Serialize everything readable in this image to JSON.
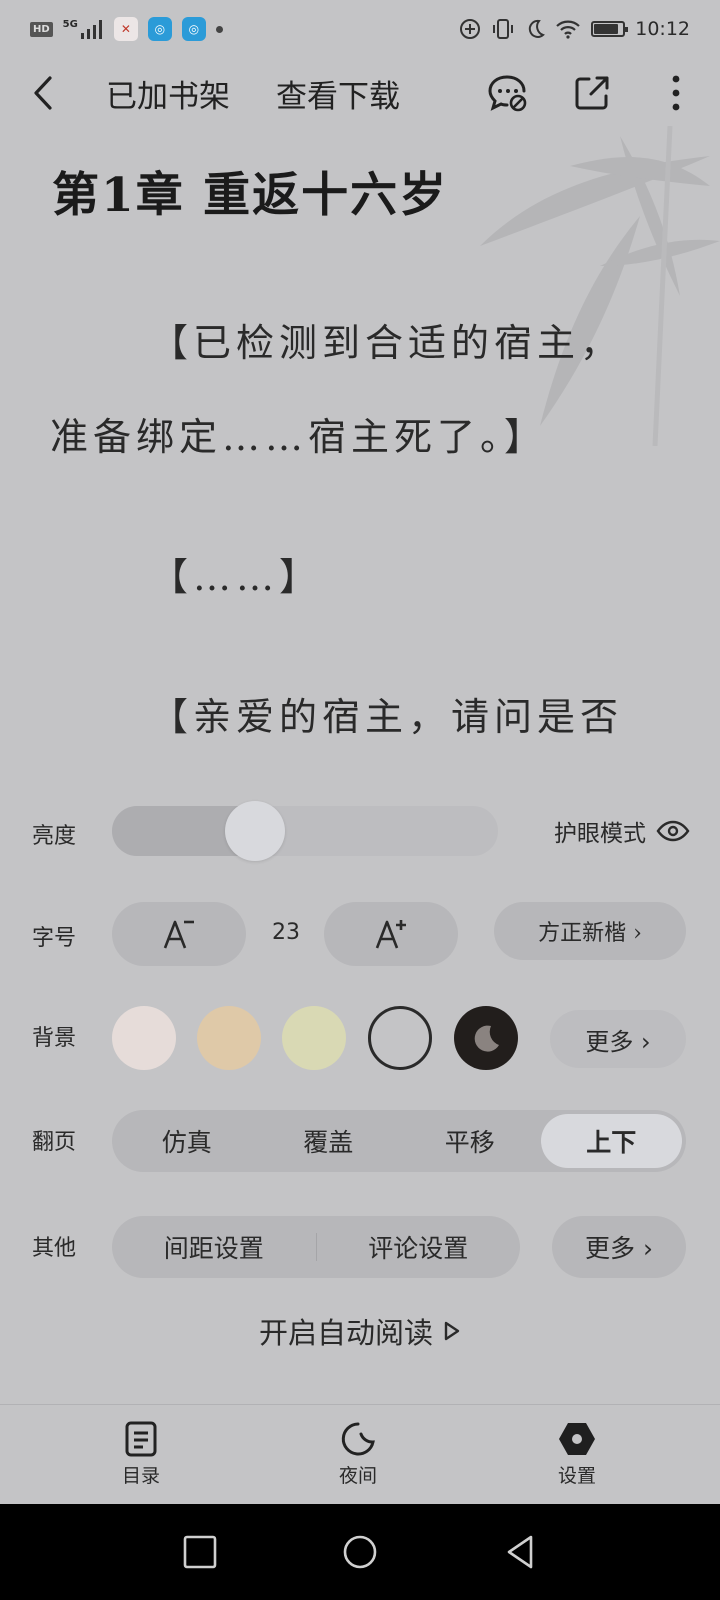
{
  "status_bar": {
    "badge": "HD",
    "network": "5G",
    "time": "10:12",
    "battery_level": 0.85
  },
  "toolbar": {
    "back_icon": "chevron-left-icon",
    "bookshelf_label": "已加书架",
    "download_label": "查看下载",
    "comment_icon": "comment-off-icon",
    "share_icon": "share-icon",
    "more_icon": "more-vertical-icon"
  },
  "reader": {
    "chapter_title": "第1章 重返十六岁",
    "paragraphs": [
      "【已检测到合适的宿主，",
      "准备绑定……宿主死了。】",
      "【……】",
      "【亲爱的宿主，请问是否"
    ]
  },
  "settings": {
    "brightness": {
      "label": "亮度",
      "level": 0.37,
      "eye_mode_label": "护眼模式"
    },
    "font": {
      "label": "字号",
      "decrease_label": "A−",
      "increase_label": "A+",
      "size_value": "23",
      "font_name": "方正新楷 ›"
    },
    "background": {
      "label": "背景",
      "swatches": [
        "#e6dcd9",
        "#dfc9a8",
        "#d9d9b4",
        "#c4c4c6",
        "#221e1c"
      ],
      "selected_index": 3,
      "more_label": "更多 ›"
    },
    "page_turn": {
      "label": "翻页",
      "options": [
        "仿真",
        "覆盖",
        "平移",
        "上下"
      ],
      "selected": "上下"
    },
    "other": {
      "label": "其他",
      "spacing_label": "间距设置",
      "comment_label": "评论设置",
      "more_label": "更多 ›"
    },
    "auto_read_label": "开启自动阅读"
  },
  "bottom_nav": {
    "items": [
      {
        "label": "目录",
        "icon": "catalog-icon"
      },
      {
        "label": "夜间",
        "icon": "moon-icon"
      },
      {
        "label": "设置",
        "icon": "settings-hexagon-icon"
      }
    ]
  },
  "system_nav": {
    "recent_icon": "square-icon",
    "home_icon": "circle-icon",
    "back_icon": "triangle-back-icon"
  }
}
